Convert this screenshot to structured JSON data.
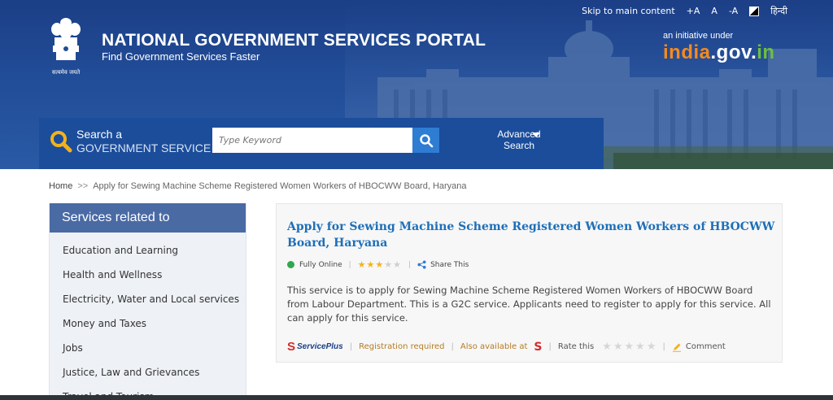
{
  "topbar": {
    "skip_link": "Skip to main content",
    "font_increase": "+A",
    "font_normal": "A",
    "font_decrease": "-A",
    "language": "हिन्दी"
  },
  "header": {
    "emblem_caption": "सत्यमेव जयते",
    "title": "NATIONAL GOVERNMENT SERVICES PORTAL",
    "tagline": "Find Government Services Faster",
    "initiative_text": "an initiative under",
    "initiative_brand_1": "india",
    "initiative_brand_2": ".gov.",
    "initiative_brand_3": "in"
  },
  "search": {
    "heading_line1": "Search a",
    "heading_line2": "GOVERNMENT SERVICE",
    "placeholder": "Type Keyword",
    "advanced_line1": "Advanced",
    "advanced_line2": "Search"
  },
  "breadcrumb": {
    "home": "Home",
    "separator": ">>",
    "current": "Apply for Sewing Machine Scheme Registered Women Workers of HBOCWW Board, Haryana"
  },
  "sidebar": {
    "heading": "Services related to",
    "items": [
      {
        "label": "Education and Learning"
      },
      {
        "label": "Health and Wellness"
      },
      {
        "label": "Electricity, Water and Local services"
      },
      {
        "label": "Money and Taxes"
      },
      {
        "label": "Jobs"
      },
      {
        "label": "Justice, Law and Grievances"
      },
      {
        "label": "Travel and Tourism"
      }
    ]
  },
  "service": {
    "title": "Apply for Sewing Machine Scheme Registered Women Workers of HBOCWW Board, Haryana",
    "status": "Fully Online",
    "status_color": "#2fa84f",
    "rating": 3,
    "rating_max": 5,
    "share": "Share This",
    "description": "This service is to apply for Sewing Machine Scheme Registered Women Workers of HBOCWW Board from Labour Department. This is a G2C service. Applicants need to register to apply for this service. All can apply for this service.",
    "provider_logo": "ServicePlus",
    "registration": "Registration required",
    "also_available": "Also available at",
    "rate_this": "Rate this",
    "comment": "Comment"
  },
  "colors": {
    "header_blue": "#214c97",
    "search_strip": "#1b4d9b",
    "sidebar_head": "#4a6aa4",
    "link_blue": "#1e6fb8",
    "star_on": "#f2b21d"
  }
}
